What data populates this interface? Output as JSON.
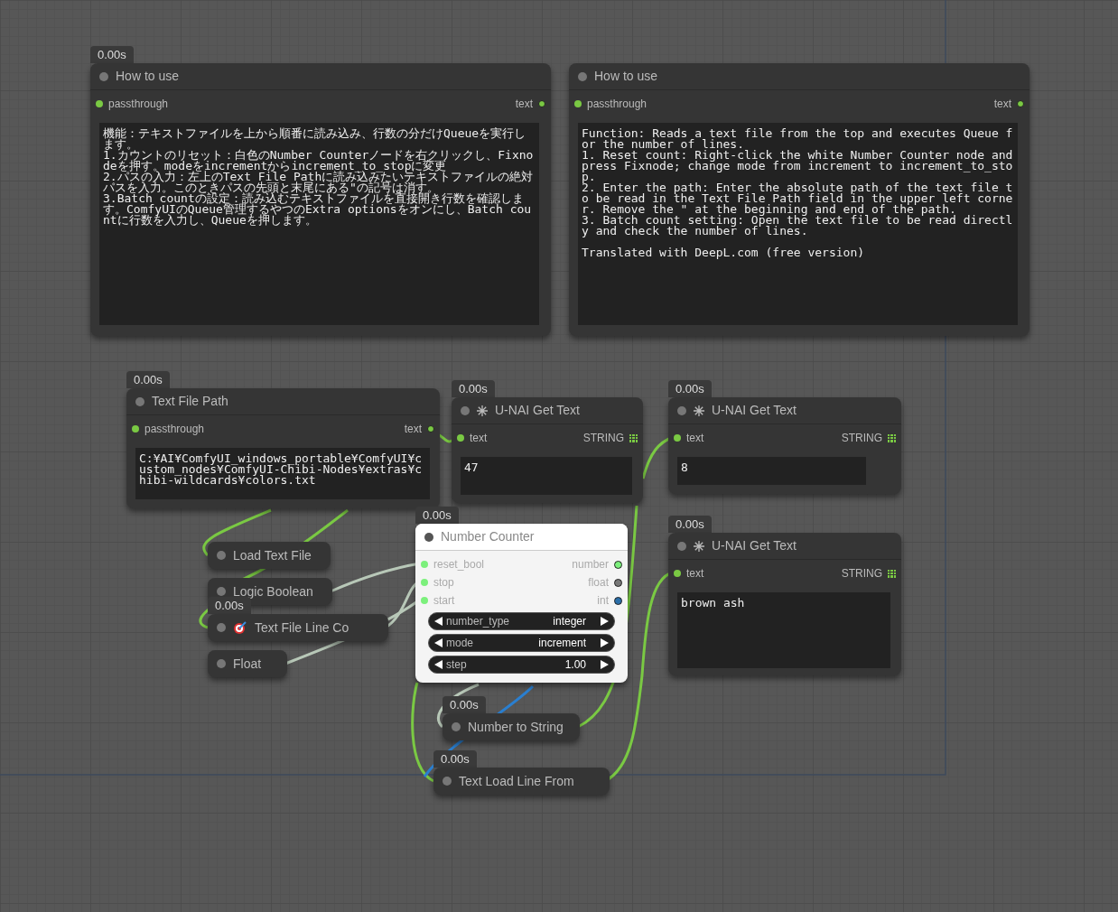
{
  "nodes": [
    {
      "kind": "note",
      "timing": "0.00s",
      "title": "How to use",
      "input": "passthrough",
      "output": "text",
      "text": "機能：テキストファイルを上から順番に読み込み、行数の分だけQueueを実行します。\n1.カウントのリセット：白色のNumber Counterノードを右クリックし、Fixnodeを押す。modeをincrementからincrement_to_stopに変更\n2.パスの入力：左上のText File Pathに読み込みたいテキストファイルの絶対パスを入力。このときパスの先頭と末尾にある\"の記号は消す。\n3.Batch countの設定：読み込むテキストファイルを直接開き行数を確認します。ComfyUIのQueue管理するやつのExtra optionsをオンにし、Batch countに行数を入力し、Queueを押します。"
    },
    {
      "kind": "note",
      "title": "How to use",
      "input": "passthrough",
      "output": "text",
      "text": "Function: Reads a text file from the top and executes Queue for the number of lines.\n1. Reset count: Right-click the white Number Counter node and press Fixnode; change mode from increment to increment_to_stop.\n2. Enter the path: Enter the absolute path of the text file to be read in the Text File Path field in the upper left corner. Remove the \" at the beginning and end of the path.\n3. Batch count setting: Open the text file to be read directly and check the number of lines.\n\nTranslated with DeepL.com (free version)"
    },
    {
      "kind": "note",
      "timing": "0.00s",
      "title": "Text File Path",
      "input": "passthrough",
      "output": "text",
      "text": "C:¥AI¥ComfyUI_windows_portable¥ComfyUI¥custom_nodes¥ComfyUI-Chibi-Nodes¥extras¥chibi-wildcards¥colors.txt"
    },
    {
      "kind": "get_text",
      "timing": "0.00s",
      "title": "U-NAI Get Text",
      "input": "text",
      "output": "STRING",
      "text": "47"
    },
    {
      "kind": "get_text",
      "timing": "0.00s",
      "title": "U-NAI Get Text",
      "input": "text",
      "output": "STRING",
      "text": "8"
    },
    {
      "kind": "get_text",
      "timing": "0.00s",
      "title": "U-NAI Get Text",
      "input": "text",
      "output": "STRING",
      "text": "brown ash"
    },
    {
      "kind": "collapsed",
      "title": "Load Text File",
      "icon": false
    },
    {
      "kind": "collapsed",
      "title": "Logic Boolean",
      "icon": false
    },
    {
      "kind": "collapsed",
      "timing": "0.00s",
      "title": "Text File Line Co",
      "icon": true
    },
    {
      "kind": "collapsed",
      "title": "Float",
      "icon": false
    },
    {
      "kind": "counter",
      "timing": "0.00s",
      "title": "Number Counter",
      "inputs": [
        "reset_bool",
        "stop",
        "start"
      ],
      "outputs": [
        {
          "label": "number",
          "color": "#7cf07c"
        },
        {
          "label": "float",
          "color": "#777777"
        },
        {
          "label": "int",
          "color": "#2a6ea8"
        }
      ],
      "widgets": [
        {
          "label": "number_type",
          "value": "integer"
        },
        {
          "label": "mode",
          "value": "increment"
        },
        {
          "label": "step",
          "value": "1.00"
        }
      ]
    },
    {
      "kind": "collapsed",
      "timing": "0.00s",
      "title": "Number to String",
      "icon": false
    },
    {
      "kind": "collapsed",
      "timing": "0.00s",
      "title": "Text Load Line From",
      "icon": false
    }
  ]
}
